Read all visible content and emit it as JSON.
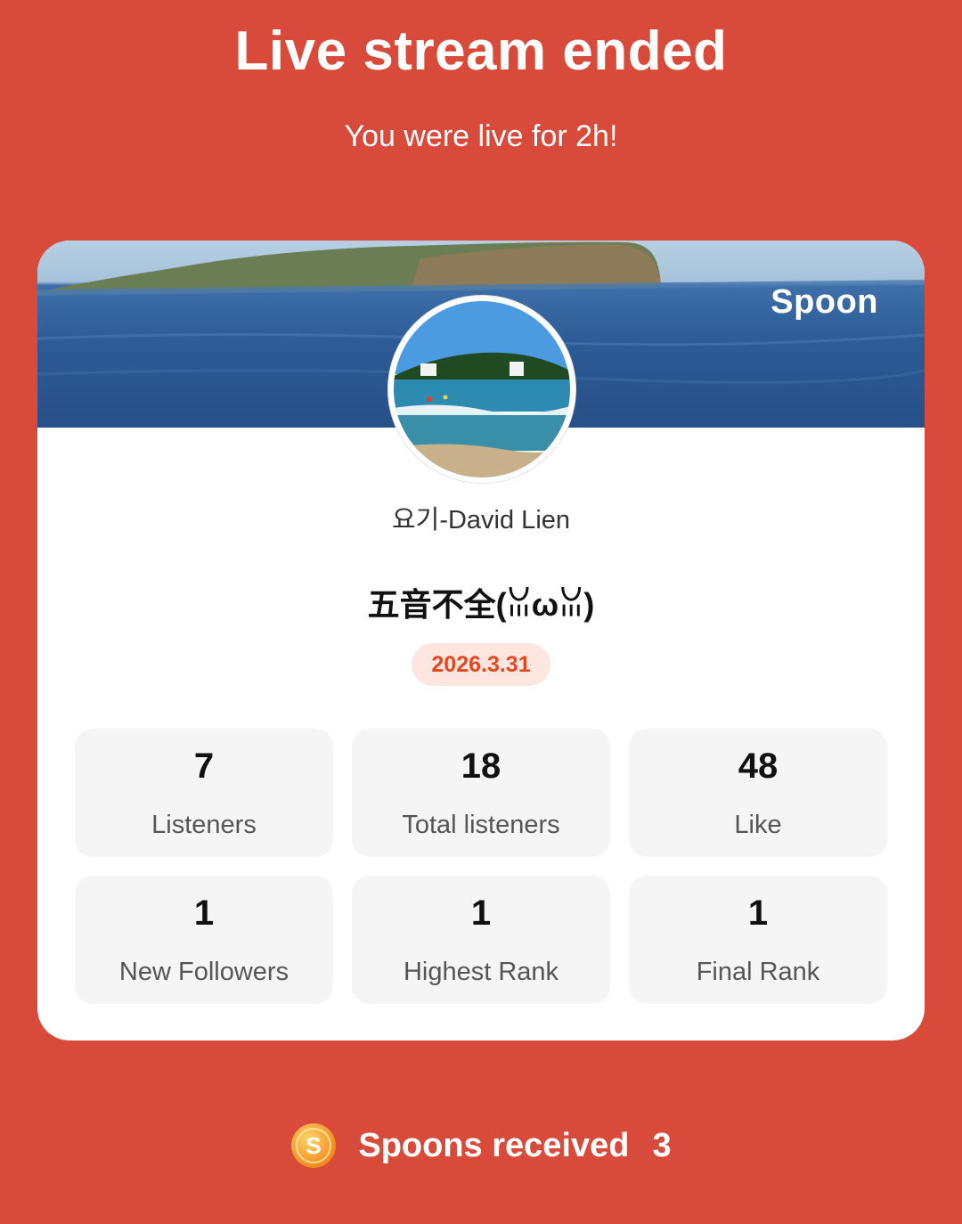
{
  "header": {
    "title": "Live stream ended",
    "subtitle": "You were live for 2h!"
  },
  "card": {
    "brand": "Spoon",
    "username": "요기-David Lien",
    "stream_title": "五音不全(ꈍωꈍ)",
    "date": "2026.3.31",
    "stats": [
      {
        "value": "7",
        "label": "Listeners"
      },
      {
        "value": "18",
        "label": "Total listeners"
      },
      {
        "value": "48",
        "label": "Like"
      },
      {
        "value": "1",
        "label": "New Followers"
      },
      {
        "value": "1",
        "label": "Highest Rank"
      },
      {
        "value": "1",
        "label": "Final Rank"
      }
    ]
  },
  "footer": {
    "label": "Spoons received",
    "count": "3",
    "icon": "spoon-coin-icon"
  },
  "colors": {
    "background": "#d84a3a",
    "date_text": "#e5471f",
    "date_pill": "#fde6df",
    "coin": "#f7a21b"
  }
}
